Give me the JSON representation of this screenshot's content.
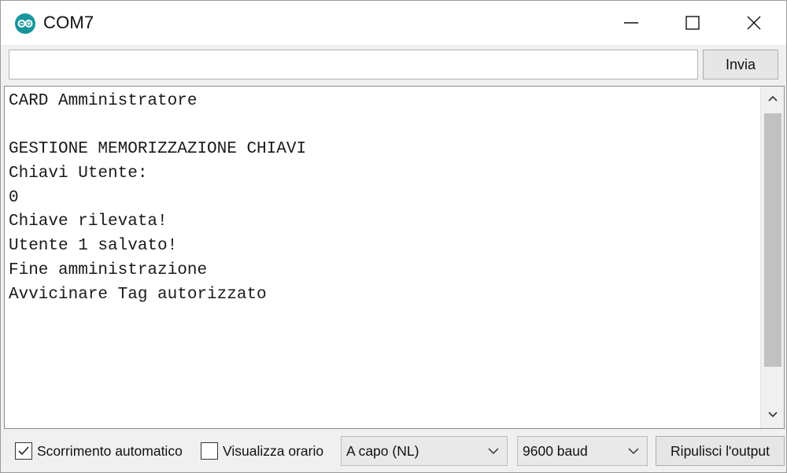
{
  "window": {
    "title": "COM7",
    "app_icon": "arduino-icon",
    "accent_color": "#16969b"
  },
  "send": {
    "input_value": "",
    "placeholder": "",
    "button_label": "Invia"
  },
  "output": {
    "lines": [
      "CARD Amministratore",
      "",
      "GESTIONE MEMORIZZAZIONE CHIAVI",
      "Chiavi Utente:",
      "0",
      "Chiave rilevata!",
      "Utente 1 salvato!",
      "Fine amministrazione",
      "Avvicinare Tag autorizzato"
    ]
  },
  "toolbar": {
    "autoscroll": {
      "label": "Scorrimento automatico",
      "checked": true
    },
    "timestamp": {
      "label": "Visualizza orario",
      "checked": false
    },
    "line_ending": "A capo (NL)",
    "baud_rate": "9600 baud",
    "clear_label": "Ripulisci l'output"
  }
}
